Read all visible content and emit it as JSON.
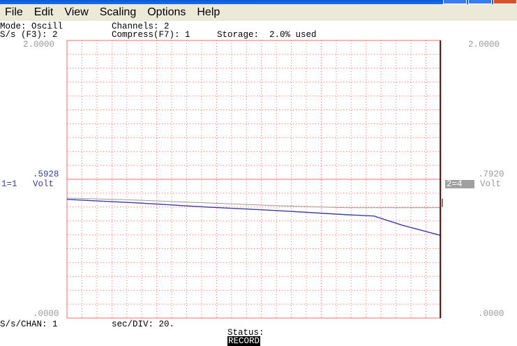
{
  "menu": [
    "File",
    "Edit",
    "View",
    "Scaling",
    "Options",
    "Help"
  ],
  "info": {
    "mode": "Mode: Oscill",
    "channels": "Channels: 2",
    "sps": "S/s (F3): 2",
    "compress": "Compress(F7): 1",
    "storage": "Storage:  2.0% used"
  },
  "left_axis": {
    "top": "2.0000",
    "mid": ".5928",
    "bottom": ".0000",
    "channel": "1=1",
    "unit": "Volt"
  },
  "right_axis": {
    "top": "2.0000",
    "mid": ".7920",
    "bottom": ".0000",
    "channel": "2=4",
    "unit": "Volt"
  },
  "footer": {
    "sps_chan": "S/s/CHAN: 1",
    "sec_div": "sec/DIV: 20.",
    "status_label": "Status:",
    "status_value": "RECORD"
  },
  "colors": {
    "grid": "#ff6b6b",
    "trace1": "#3a3aa8",
    "trace2": "#9a9a9a",
    "cursor": "#000000"
  },
  "chart_data": {
    "type": "line",
    "ylim_ch1": [
      0,
      2.0
    ],
    "ylim_ch2": [
      0,
      2.0
    ],
    "series": [
      {
        "name": "1=1",
        "x": [
          0,
          100,
          200,
          300,
          400,
          440,
          480,
          536
        ],
        "y": [
          0.855,
          0.83,
          0.8,
          0.775,
          0.745,
          0.735,
          0.67,
          0.595
        ]
      },
      {
        "name": "2=4",
        "x": [
          0,
          100,
          200,
          300,
          400,
          450,
          536
        ],
        "y": [
          0.865,
          0.85,
          0.83,
          0.81,
          0.795,
          0.795,
          0.795
        ]
      }
    ]
  }
}
